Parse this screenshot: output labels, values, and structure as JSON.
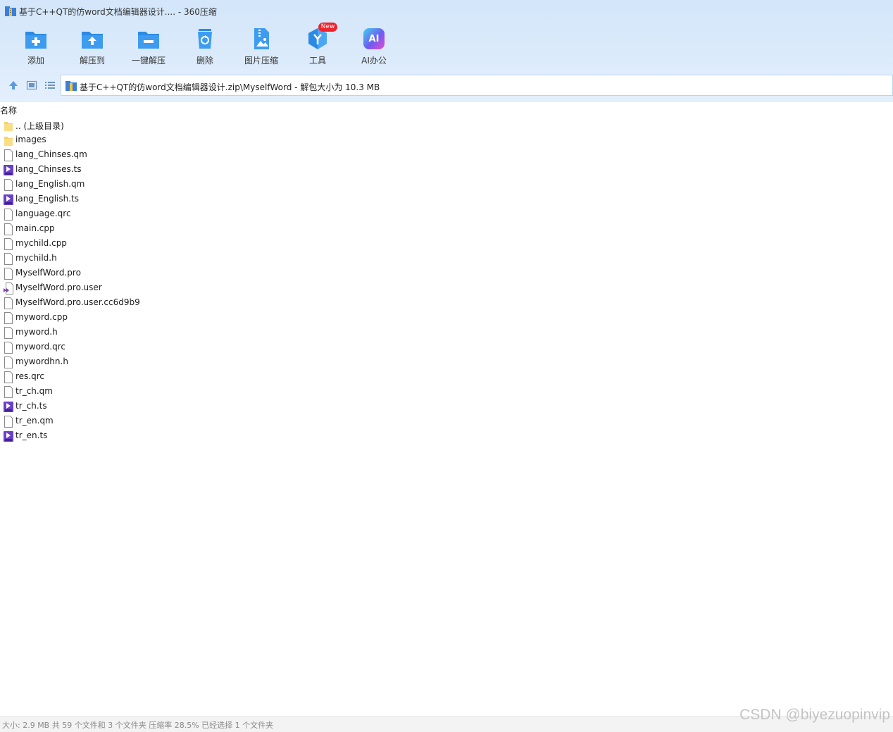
{
  "window": {
    "title": "基于C++QT的仿word文档编辑器设计.... - 360压缩"
  },
  "toolbar": {
    "buttons": [
      {
        "label": "添加",
        "icon": "add-folder-icon"
      },
      {
        "label": "解压到",
        "icon": "extract-to-icon"
      },
      {
        "label": "一键解压",
        "icon": "one-click-extract-icon"
      },
      {
        "label": "删除",
        "icon": "recycle-delete-icon"
      },
      {
        "label": "图片压缩",
        "icon": "image-compress-icon"
      },
      {
        "label": "工具",
        "icon": "tools-icon",
        "badge": "New"
      },
      {
        "label": "AI办公",
        "icon": "ai-office-icon",
        "icon_text": "AI"
      }
    ]
  },
  "address": {
    "path": "基于C++QT的仿word文档编辑器设计.zip\\MyselfWord - 解包大小为 10.3 MB"
  },
  "columns": {
    "name": "名称"
  },
  "files": [
    {
      "name": ".. (上级目录)",
      "type": "folder"
    },
    {
      "name": "images",
      "type": "folder"
    },
    {
      "name": "lang_Chinses.qm",
      "type": "file"
    },
    {
      "name": "lang_Chinses.ts",
      "type": "ts"
    },
    {
      "name": "lang_English.qm",
      "type": "file"
    },
    {
      "name": "lang_English.ts",
      "type": "ts"
    },
    {
      "name": "language.qrc",
      "type": "file"
    },
    {
      "name": "main.cpp",
      "type": "file"
    },
    {
      "name": "mychild.cpp",
      "type": "file"
    },
    {
      "name": "mychild.h",
      "type": "file"
    },
    {
      "name": "MyselfWord.pro",
      "type": "file"
    },
    {
      "name": "MyselfWord.pro.user",
      "type": "vs"
    },
    {
      "name": "MyselfWord.pro.user.cc6d9b9",
      "type": "file"
    },
    {
      "name": "myword.cpp",
      "type": "file"
    },
    {
      "name": "myword.h",
      "type": "file"
    },
    {
      "name": "myword.qrc",
      "type": "file"
    },
    {
      "name": "mywordhn.h",
      "type": "file"
    },
    {
      "name": "res.qrc",
      "type": "file"
    },
    {
      "name": "tr_ch.qm",
      "type": "file"
    },
    {
      "name": "tr_ch.ts",
      "type": "ts"
    },
    {
      "name": "tr_en.qm",
      "type": "file"
    },
    {
      "name": "tr_en.ts",
      "type": "ts"
    }
  ],
  "status": {
    "text": "大小: 2.9 MB 共 59 个文件和 3 个文件夹 压缩率 28.5% 已经选择 1 个文件夹"
  },
  "watermark": "CSDN @biyezuopinvip",
  "colors": {
    "accent_blue": "#2b8ae6",
    "folder_yellow": "#f6d36a",
    "ts_purple": "#6a3fc8",
    "badge_red": "#f0232c"
  }
}
